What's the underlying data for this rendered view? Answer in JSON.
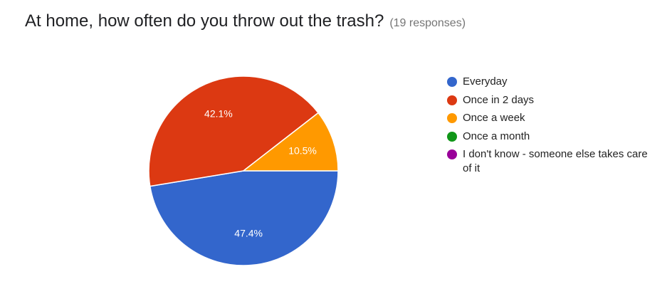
{
  "header": {
    "title": "At home, how often do you throw out the trash?",
    "responses": "(19 responses)"
  },
  "chart_data": {
    "type": "pie",
    "title": "At home, how often do you throw out the trash?",
    "categories": [
      "Everyday",
      "Once in 2 days",
      "Once a week",
      "Once a month",
      "I don't know - someone else takes care of it"
    ],
    "values": [
      47.4,
      42.1,
      10.5,
      0,
      0
    ],
    "labels": [
      "47.4%",
      "42.1%",
      "10.5%",
      "",
      ""
    ],
    "colors": [
      "#3366cc",
      "#dc3912",
      "#ff9900",
      "#109618",
      "#990099"
    ],
    "legend_position": "right"
  }
}
